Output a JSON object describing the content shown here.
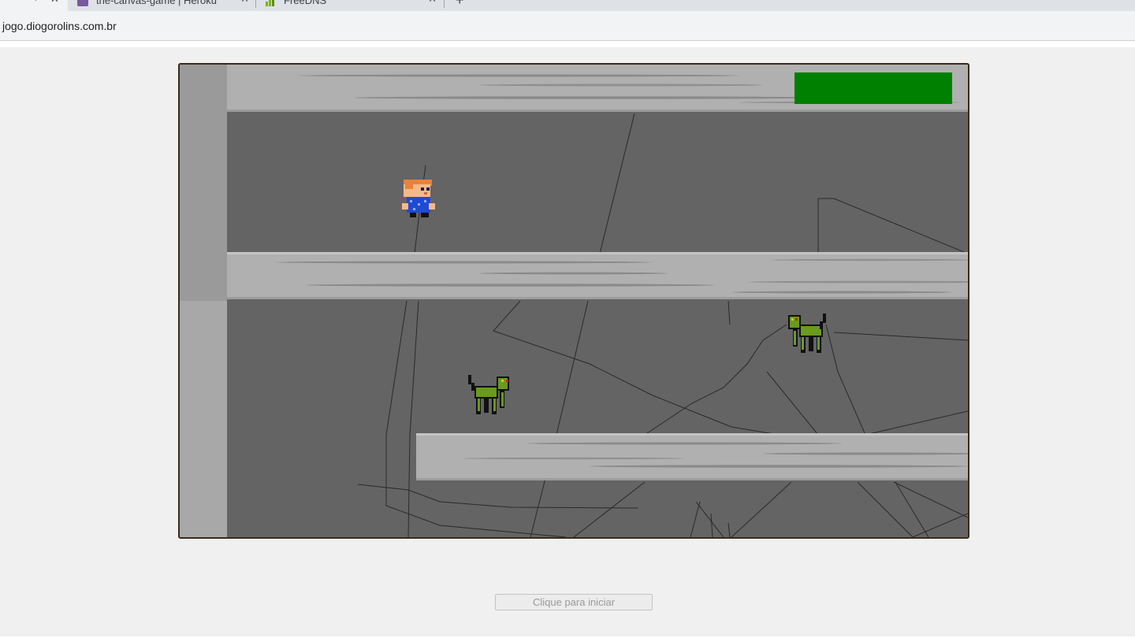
{
  "browser": {
    "tabs": [
      {
        "title": "the-canvas-game | Heroku",
        "icon": "heroku-icon",
        "icon_color": "#79589f"
      },
      {
        "title": "FreeDNS",
        "icon": "bar-chart-icon",
        "icon_color": "#7ab317"
      }
    ],
    "url": "jogo.diogorolins.com.br"
  },
  "game": {
    "health_bar_color": "#008000",
    "health": 1.0,
    "floor_color": "#646464",
    "platform_color": "#b0b0b0",
    "player": "boy-sprite",
    "enemies": [
      "green-cat-sprite",
      "green-cat-sprite"
    ]
  },
  "start_button": {
    "label": "Clique para iniciar"
  }
}
